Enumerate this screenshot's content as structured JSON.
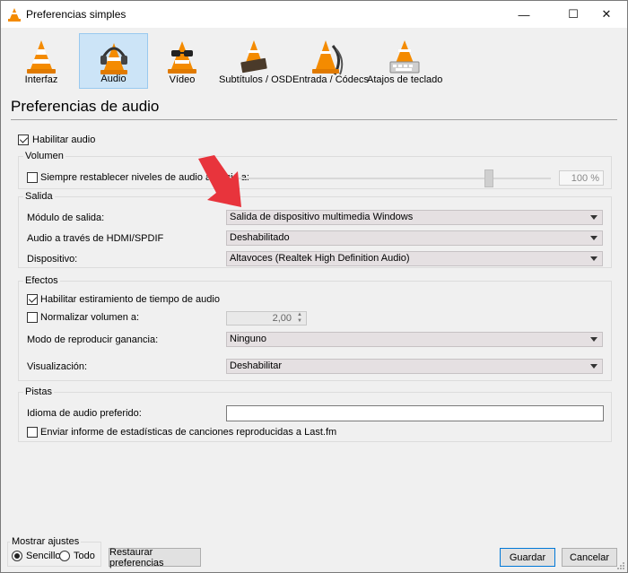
{
  "window": {
    "title": "Preferencias simples",
    "controls": {
      "minimize": "—",
      "maximize": "☐",
      "close": "✕"
    }
  },
  "toolbar": {
    "items": [
      {
        "label": "Interfaz",
        "icon": "vlc-cone-icon",
        "selected": false
      },
      {
        "label": "Audio",
        "icon": "headphones-cone-icon",
        "selected": true
      },
      {
        "label": "Vídeo",
        "icon": "glasses-cone-icon",
        "selected": false
      },
      {
        "label": "Subtítulos / OSD",
        "icon": "subtitles-cone-icon",
        "selected": false
      },
      {
        "label": "Entrada / Códecs",
        "icon": "cable-cone-icon",
        "selected": false
      },
      {
        "label": "Atajos de teclado",
        "icon": "hotkeys-cone-icon",
        "selected": false
      }
    ]
  },
  "page": {
    "title": "Preferencias de audio"
  },
  "enable_audio": {
    "label": "Habilitar audio",
    "checked": true
  },
  "volume": {
    "group_title": "Volumen",
    "reset_label": "Siempre restablecer niveles de audio al inicio a:",
    "reset_checked": false,
    "level_value": "100 %",
    "level_fraction": 0.8
  },
  "output": {
    "group_title": "Salida",
    "module_label": "Módulo de salida:",
    "module_value": "Salida de dispositivo multimedia Windows",
    "hdmi_label": "Audio a través de HDMI/SPDIF",
    "hdmi_value": "Deshabilitado",
    "device_label": "Dispositivo:",
    "device_value": "Altavoces (Realtek High Definition Audio)"
  },
  "effects": {
    "group_title": "Efectos",
    "stretch_label": "Habilitar estiramiento de tiempo de audio",
    "stretch_checked": true,
    "normalize_label": "Normalizar volumen a:",
    "normalize_checked": false,
    "normalize_value": "2,00",
    "gain_label": "Modo de reproducir ganancia:",
    "gain_value": "Ninguno",
    "visual_label": "Visualización:",
    "visual_value": "Deshabilitar"
  },
  "tracks": {
    "group_title": "Pistas",
    "language_label": "Idioma de audio preferido:",
    "language_value": "",
    "lastfm_label": "Enviar informe de estadísticas de canciones reproducidas a Last.fm",
    "lastfm_checked": false
  },
  "footer": {
    "show_settings_title": "Mostrar ajustes",
    "simple_label": "Sencillo",
    "all_label": "Todo",
    "simple_selected": true,
    "reset_button": "Restaurar preferencias",
    "save_button": "Guardar",
    "cancel_button": "Cancelar"
  },
  "colors": {
    "accent": "#0078d7",
    "selected_bg": "#cce4f7",
    "annotation_arrow": "#e8343c"
  }
}
